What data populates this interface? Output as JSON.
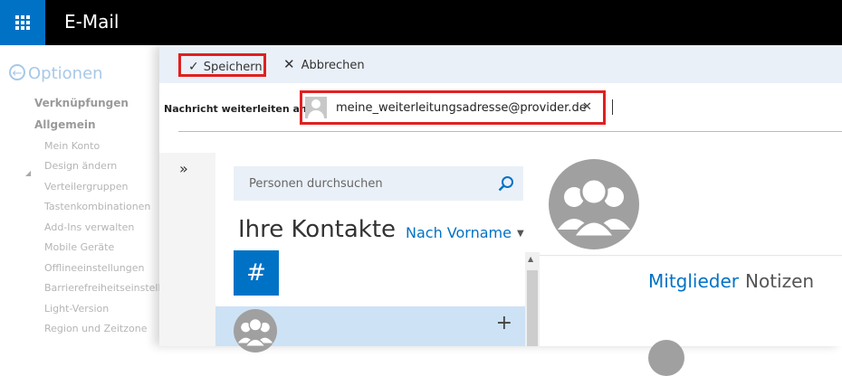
{
  "app": {
    "title": "E-Mail"
  },
  "options_nav": {
    "header": "Optionen",
    "links": "Verknüpfungen",
    "general": "Allgemein",
    "items": [
      "Mein Konto",
      "Design ändern",
      "Verteilergruppen",
      "Tastenkombinationen",
      "Add-Ins verwalten",
      "Mobile Geräte",
      "Offlineeinstellungen",
      "Barrierefreiheitseinstellungen",
      "Light-Version",
      "Region und Zeitzone"
    ]
  },
  "toolbar": {
    "save_label": "Speichern",
    "cancel_label": "Abbrechen"
  },
  "forward": {
    "label": "Nachricht weiterleiten an...",
    "recipient": "meine_weiterleitungsadresse@provider.de"
  },
  "contacts": {
    "expand_glyph": "»",
    "search_placeholder": "Personen durchsuchen",
    "title": "Ihre Kontakte",
    "sort_label": "Nach Vorname",
    "index_letter": "#"
  },
  "detail": {
    "tab_members": "Mitglieder",
    "tab_notes": "Notizen"
  },
  "colors": {
    "accent": "#0072c6",
    "highlight": "#e02020",
    "selected_row": "#cde2f5"
  }
}
